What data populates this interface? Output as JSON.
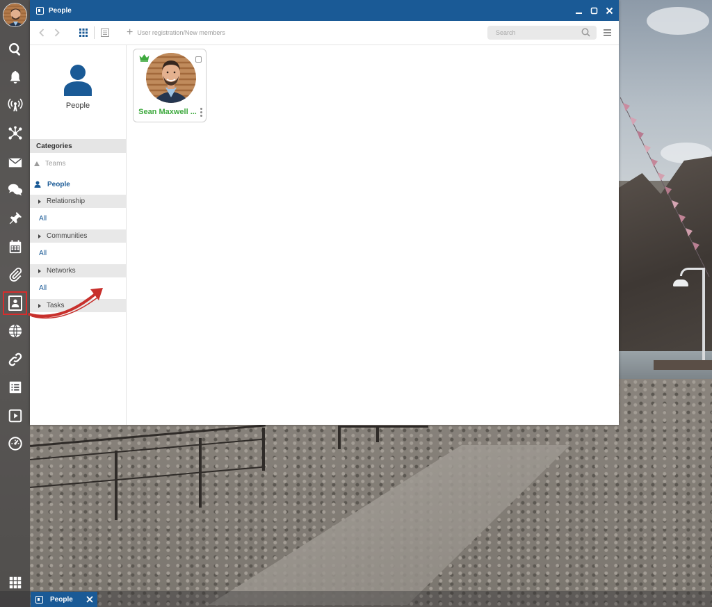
{
  "window": {
    "title": "People"
  },
  "toolbar": {
    "add_label": "User registration/New members",
    "search_placeholder": "Search"
  },
  "sidebar": {
    "profile_label": "People",
    "categories_header": "Categories",
    "teams_label": "Teams",
    "people_label": "People",
    "groups": [
      {
        "label": "Relationship",
        "all": "All"
      },
      {
        "label": "Communities",
        "all": "All"
      },
      {
        "label": "Networks",
        "all": "All"
      },
      {
        "label": "Tasks"
      }
    ]
  },
  "cards": [
    {
      "name": "Sean Maxwell ...",
      "badge": "crown-icon",
      "badge_color": "#3ea93e"
    }
  ],
  "taskbar": {
    "items": [
      {
        "label": "People"
      }
    ]
  },
  "dock": {
    "items": [
      "avatar",
      "search-icon",
      "bell-icon",
      "broadcast-icon",
      "network-icon",
      "mail-icon",
      "chat-icon",
      "pin-icon",
      "calendar-icon",
      "paperclip-icon",
      "contacts-icon",
      "globe-icon",
      "link-icon",
      "list-icon",
      "play-icon",
      "gauge-icon",
      "apps-grid-icon"
    ],
    "active": "contacts-icon"
  },
  "colors": {
    "accent": "#1a5a96",
    "name_green": "#3ea93e",
    "highlight_red": "#d72d2d"
  }
}
